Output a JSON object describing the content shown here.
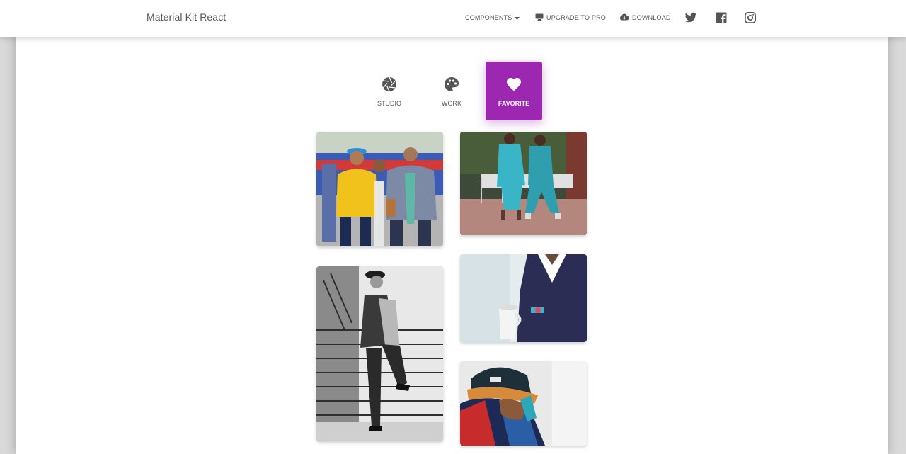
{
  "navbar": {
    "brand": "Material Kit React",
    "links": [
      {
        "label": "COMPONENTS",
        "icon": "caret-down-icon"
      },
      {
        "label": "UPGRADE TO PRO",
        "icon": "monitor-icon"
      },
      {
        "label": "DOWNLOAD",
        "icon": "cloud-download-icon"
      }
    ],
    "social": [
      "twitter-icon",
      "facebook-icon",
      "instagram-icon"
    ]
  },
  "tabs": [
    {
      "label": "STUDIO",
      "icon": "camera-aperture-icon",
      "active": false
    },
    {
      "label": "WORK",
      "icon": "palette-icon",
      "active": false
    },
    {
      "label": "FAVORITE",
      "icon": "heart-icon",
      "active": true
    }
  ],
  "colors": {
    "accent": "#9c27b0",
    "text": "#555555",
    "background": "#d9d9d9"
  },
  "gallery": {
    "left_column": [
      "photo-men-yellow-suit",
      "photo-woman-black-white-stairs"
    ],
    "right_column": [
      "photo-women-blue-outfits",
      "photo-man-navy-blazer-cup",
      "photo-man-orange-cap"
    ]
  }
}
